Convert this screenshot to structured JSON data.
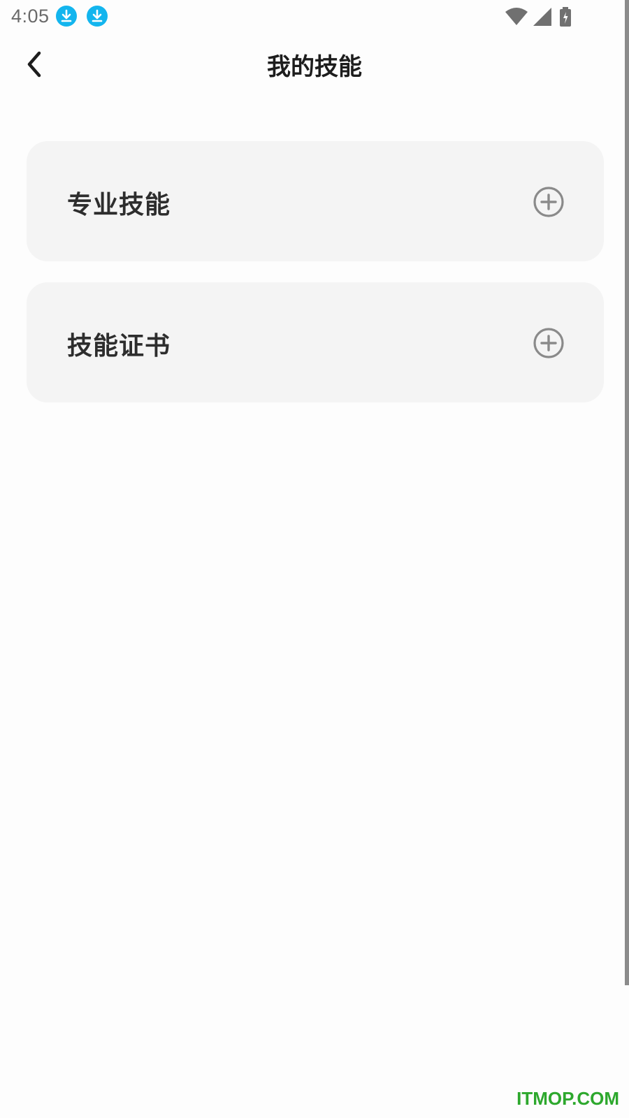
{
  "status_bar": {
    "time": "4:05",
    "icons": [
      "download-notification-icon",
      "download-notification-icon",
      "wifi-icon",
      "cellular-signal-icon",
      "battery-charging-icon"
    ]
  },
  "header": {
    "back_icon": "chevron-left-icon",
    "title": "我的技能"
  },
  "skill_sections": [
    {
      "label": "专业技能",
      "action_icon": "add-circle-icon"
    },
    {
      "label": "技能证书",
      "action_icon": "add-circle-icon"
    }
  ],
  "watermark": "ITMOP.COM",
  "colors": {
    "card_background": "#f4f4f4",
    "notification_accent": "#13b5ee",
    "add_icon": "#8a8a8a",
    "watermark": "#2da82d"
  }
}
